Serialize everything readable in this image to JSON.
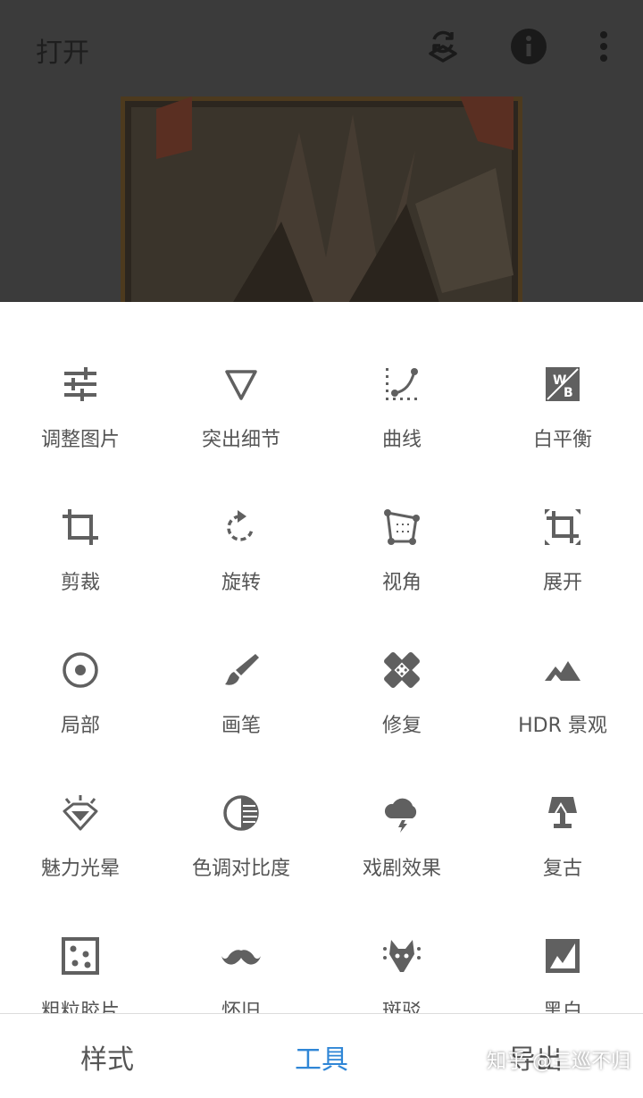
{
  "header": {
    "open_label": "打开",
    "icons": [
      "layers-icon",
      "info-icon",
      "more-icon"
    ]
  },
  "tools": [
    {
      "label": "调整图片",
      "icon": "tune-icon"
    },
    {
      "label": "突出细节",
      "icon": "details-triangle-icon"
    },
    {
      "label": "曲线",
      "icon": "curves-icon"
    },
    {
      "label": "白平衡",
      "icon": "white-balance-icon"
    },
    {
      "label": "剪裁",
      "icon": "crop-icon"
    },
    {
      "label": "旋转",
      "icon": "rotate-icon"
    },
    {
      "label": "视角",
      "icon": "perspective-icon"
    },
    {
      "label": "展开",
      "icon": "expand-icon"
    },
    {
      "label": "局部",
      "icon": "selective-icon"
    },
    {
      "label": "画笔",
      "icon": "brush-icon"
    },
    {
      "label": "修复",
      "icon": "healing-icon"
    },
    {
      "label": "HDR 景观",
      "icon": "hdr-mountain-icon"
    },
    {
      "label": "魅力光晕",
      "icon": "glamour-glow-icon"
    },
    {
      "label": "色调对比度",
      "icon": "tonal-contrast-icon"
    },
    {
      "label": "戏剧效果",
      "icon": "drama-cloud-icon"
    },
    {
      "label": "复古",
      "icon": "vintage-lamp-icon"
    },
    {
      "label": "粗粒胶片",
      "icon": "grainy-film-icon"
    },
    {
      "label": "怀旧",
      "icon": "retrolux-mustache-icon"
    },
    {
      "label": "斑驳",
      "icon": "grunge-icon"
    },
    {
      "label": "黑白",
      "icon": "black-white-icon"
    }
  ],
  "nav": {
    "styles": "样式",
    "tools": "工具",
    "export": "导出",
    "active": "tools"
  },
  "watermark": "知乎 @三巡不归",
  "colors": {
    "accent": "#2f86d6",
    "icon": "#606060",
    "label": "#555555",
    "dim_overlay": "#3b3b3b"
  }
}
